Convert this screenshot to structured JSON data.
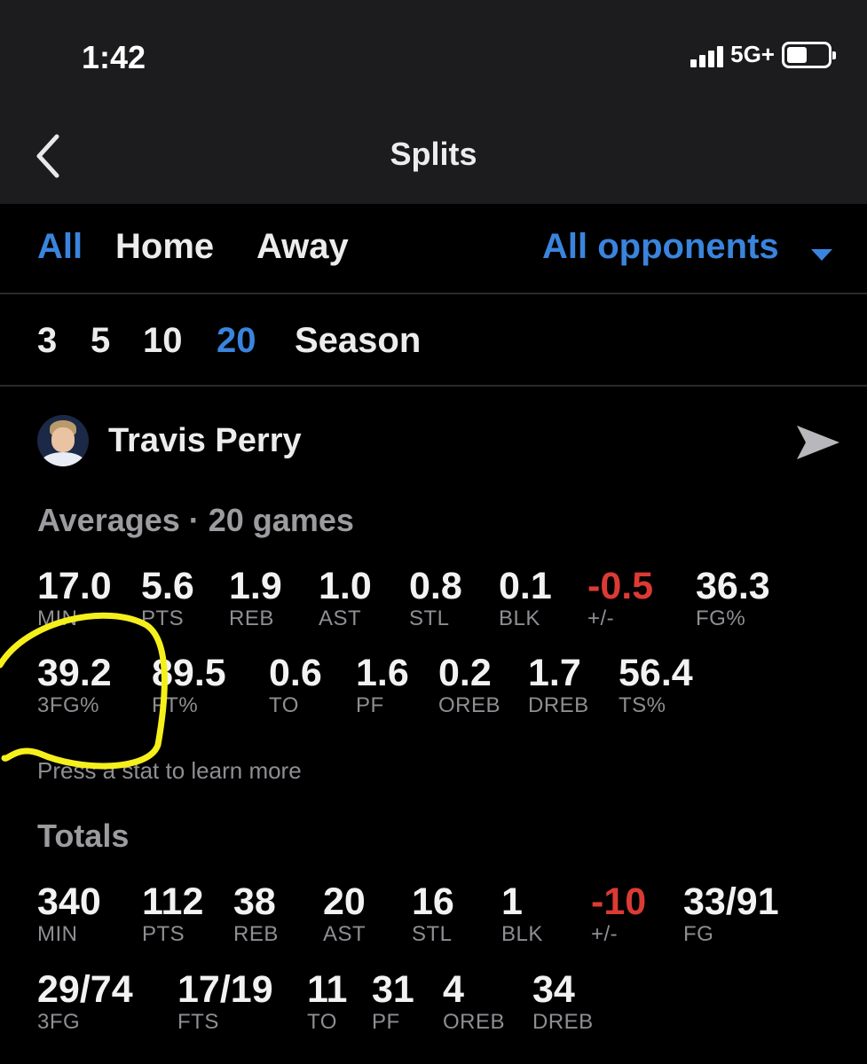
{
  "status_bar": {
    "time": "1:42",
    "network": "5G+"
  },
  "header": {
    "title": "Splits"
  },
  "location_filters": [
    {
      "label": "All",
      "selected": true
    },
    {
      "label": "Home",
      "selected": false
    },
    {
      "label": "Away",
      "selected": false
    }
  ],
  "opponent_filter": {
    "label": "All opponents"
  },
  "game_ranges": [
    {
      "label": "3",
      "selected": false
    },
    {
      "label": "5",
      "selected": false
    },
    {
      "label": "10",
      "selected": false
    },
    {
      "label": "20",
      "selected": true
    },
    {
      "label": "Season",
      "selected": false
    }
  ],
  "player": {
    "name": "Travis Perry"
  },
  "averages": {
    "title": "Averages · 20 games",
    "stats": [
      {
        "value": "17.0",
        "label": "MIN"
      },
      {
        "value": "5.6",
        "label": "PTS"
      },
      {
        "value": "1.9",
        "label": "REB"
      },
      {
        "value": "1.0",
        "label": "AST"
      },
      {
        "value": "0.8",
        "label": "STL"
      },
      {
        "value": "0.1",
        "label": "BLK"
      },
      {
        "value": "-0.5",
        "label": "+/-",
        "negative": true
      },
      {
        "value": "36.3",
        "label": "FG%"
      },
      {
        "value": "39.2",
        "label": "3FG%"
      },
      {
        "value": "89.5",
        "label": "FT%"
      },
      {
        "value": "0.6",
        "label": "TO"
      },
      {
        "value": "1.6",
        "label": "PF"
      },
      {
        "value": "0.2",
        "label": "OREB"
      },
      {
        "value": "1.7",
        "label": "DREB"
      },
      {
        "value": "56.4",
        "label": "TS%"
      }
    ],
    "hint": "Press a stat to learn more"
  },
  "totals": {
    "title": "Totals",
    "stats": [
      {
        "value": "340",
        "label": "MIN"
      },
      {
        "value": "112",
        "label": "PTS"
      },
      {
        "value": "38",
        "label": "REB"
      },
      {
        "value": "20",
        "label": "AST"
      },
      {
        "value": "16",
        "label": "STL"
      },
      {
        "value": "1",
        "label": "BLK"
      },
      {
        "value": "-10",
        "label": "+/-",
        "negative": true
      },
      {
        "value": "33/91",
        "label": "FG"
      },
      {
        "value": "29/74",
        "label": "3FG"
      },
      {
        "value": "17/19",
        "label": "FTS"
      },
      {
        "value": "11",
        "label": "TO"
      },
      {
        "value": "31",
        "label": "PF"
      },
      {
        "value": "4",
        "label": "OREB"
      },
      {
        "value": "34",
        "label": "DREB"
      }
    ]
  },
  "colors": {
    "accent": "#3a84dd",
    "negative": "#dc3b34",
    "annotation": "#f5f01c",
    "background": "#000000",
    "header_bg": "#1c1c1e"
  },
  "icons": {
    "back": "chevron-left-icon",
    "dropdown": "caret-down-icon",
    "share": "send-arrow-icon",
    "signal": "signal-bars-icon",
    "battery": "battery-icon"
  }
}
